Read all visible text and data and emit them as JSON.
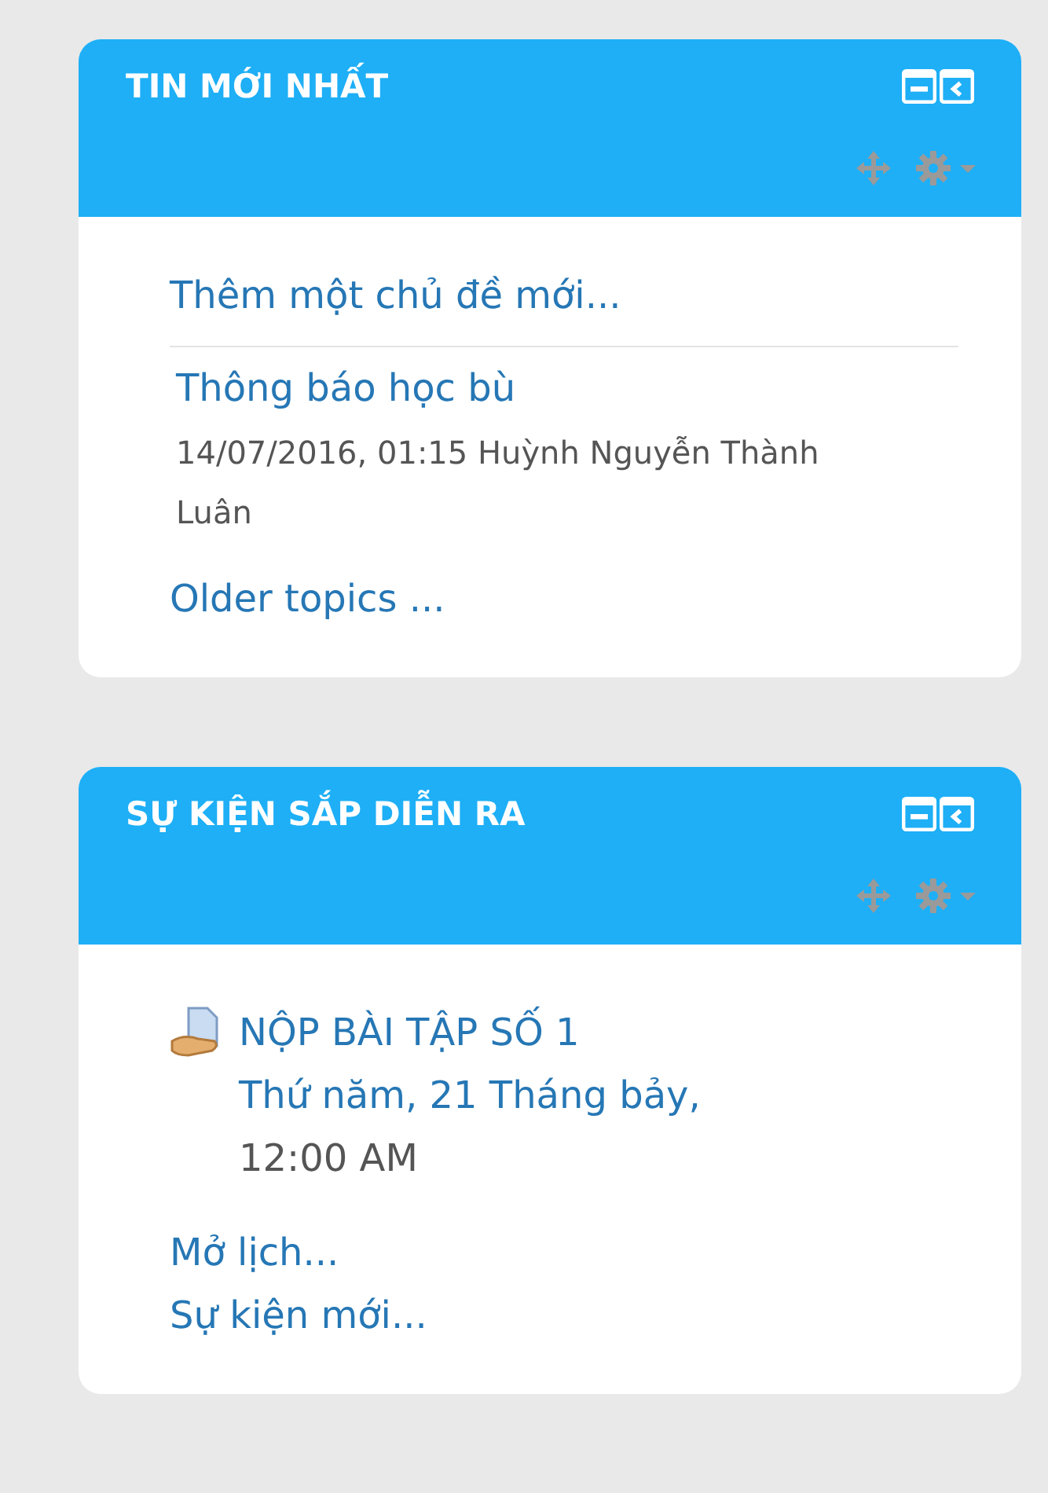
{
  "blocks": [
    {
      "kind": "news",
      "title": "TIN MỚI NHẤT",
      "add_link": "Thêm một chủ đề mới...",
      "posts": [
        {
          "subject": "Thông báo học bù",
          "date": "14/07/2016, 01:15",
          "author": "Huỳnh Nguyễn Thành Luân"
        }
      ],
      "footer_links": [
        "Older topics ..."
      ]
    },
    {
      "kind": "events",
      "title": "SỰ KIỆN SẮP DIỄN RA",
      "events": [
        {
          "name": "NỘP BÀI TẬP SỐ 1",
          "date": "Thứ năm, 21 Tháng bảy,",
          "time": "12:00 AM"
        }
      ],
      "footer_links": [
        "Mở lịch...",
        "Sự kiện mới..."
      ]
    }
  ]
}
